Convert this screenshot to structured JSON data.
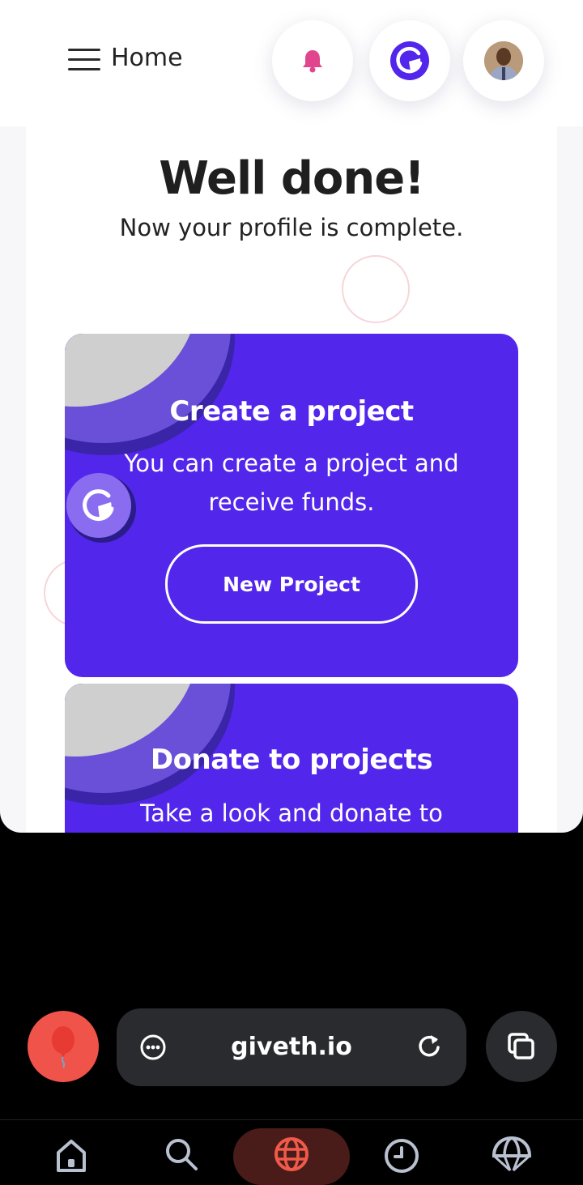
{
  "header": {
    "title": "Home"
  },
  "hero": {
    "title": "Well done!",
    "subtitle": "Now your profile is complete."
  },
  "cards": [
    {
      "title": "Create a project",
      "text_line1": "You can create a project and",
      "text_line2": "receive funds.",
      "button": "New Project"
    },
    {
      "title": "Donate to projects",
      "text_line1": "Take a look and donate to"
    }
  ],
  "browser": {
    "url": "giveth.io"
  },
  "colors": {
    "primary": "#5326ec",
    "bell": "#e1458d",
    "balloon": "#f0534a",
    "accent_nav": "#ef5a4a"
  }
}
